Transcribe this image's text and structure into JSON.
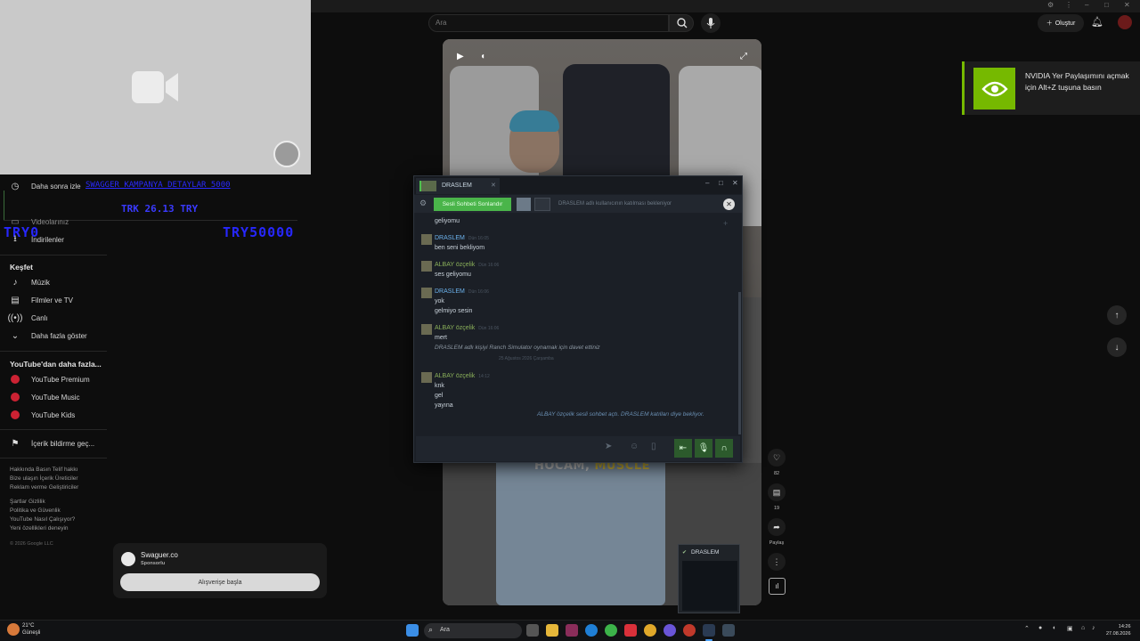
{
  "colors": {
    "accent_green": "#76b900",
    "steam_green": "#4ab54a",
    "donation_blue": "#2a2aff"
  },
  "overlay": {
    "donation_link": "SWAGGER KAMPANYA DETAYLAR 5000",
    "donation_amount": "TRK 26.13 TRY",
    "donation_left": "TRY0",
    "donation_right": "TRY50000"
  },
  "header": {
    "search_placeholder": "Ara",
    "create_label": "Oluştur"
  },
  "sidebar": {
    "top_items": [
      {
        "label": "Daha sonra izle",
        "icon": "clock-icon"
      },
      {
        "label": "Videolarınız",
        "icon": "video-icon"
      },
      {
        "label": "İndirilenler",
        "icon": "download-icon"
      }
    ],
    "explore_heading": "Keşfet",
    "explore_items": [
      {
        "label": "Müzik",
        "icon": "music-icon"
      },
      {
        "label": "Filmler ve TV",
        "icon": "film-icon"
      },
      {
        "label": "Canlı",
        "icon": "live-icon"
      },
      {
        "label": "Daha fazla göster",
        "icon": "chevron-down-icon"
      }
    ],
    "more_heading": "YouTube'dan daha fazla...",
    "more_items": [
      {
        "label": "YouTube Premium"
      },
      {
        "label": "YouTube Music"
      },
      {
        "label": "YouTube Kids"
      }
    ],
    "report_label": "İçerik bildirme geç...",
    "footer_lines": [
      "Hakkında  Basın  Telif hakkı",
      "Bize ulaşın  İçerik Üreticiler",
      "Reklam verme  Geliştiriciler",
      "Şartlar  Gizlilik",
      "Politika ve Güvenlik",
      "YouTube Nasıl Çalışıyor?",
      "Yeni özellikleri deneyin"
    ],
    "copyright": "© 2026 Google LLC"
  },
  "ad": {
    "name": "Swaguer.co",
    "sponsored": "Sponsorlu",
    "cta": "Alışverişe başla"
  },
  "video": {
    "caption_white": "HOCAM, ",
    "caption_yellow": "MUSCLE"
  },
  "actions": {
    "likes": "82",
    "comments": "19",
    "share_label": "Paylaş"
  },
  "nvidia": {
    "text": "NVIDIA Yer Paylaşımını açmak için Alt+Z tuşuna basın"
  },
  "chat": {
    "tab_name": "DRASLEM",
    "voice_button": "Sesli Sohbeti Sonlandır",
    "voice_wait": "DRASLEM adlı kullanıcının katılması bekleniyor",
    "messages": [
      {
        "name": "",
        "time": "",
        "lines": [
          "geliyomu"
        ]
      },
      {
        "name": "DRASLEM",
        "time": "Dün 16:05",
        "lines": [
          "ben seni bekliyom"
        ],
        "color": "blue"
      },
      {
        "name": "ALBAY özçelik",
        "time": "Dün 16:06",
        "lines": [
          "ses geliyomu"
        ],
        "color": "green"
      },
      {
        "name": "DRASLEM",
        "time": "Dün 16:06",
        "lines": [
          "yok",
          "gelmiyo sesin"
        ],
        "color": "blue"
      },
      {
        "name": "ALBAY özçelik",
        "time": "Dün 16:06",
        "lines": [
          "mert"
        ],
        "color": "green"
      },
      {
        "name": "ALBAY özçelik",
        "time": "14:12",
        "lines": [
          "knk",
          "gel",
          "yayına"
        ],
        "color": "green"
      }
    ],
    "invite_text": "DRASLEM adlı kişiyi  Ranch Simulator oynamak için davet ettiniz",
    "date_separator": "25 Ağustos 2026 Çarşamba",
    "voice_system": "ALBAY özçelik sesli sohbet açtı. DRASLEM katılları diye bekliyor."
  },
  "mini_preview": {
    "title": "DRASLEM"
  },
  "taskbar": {
    "weather_temp": "21°C",
    "weather_desc": "Güneşli",
    "search_placeholder": "Ara",
    "time": "14:26",
    "date": "27.08.2026"
  }
}
